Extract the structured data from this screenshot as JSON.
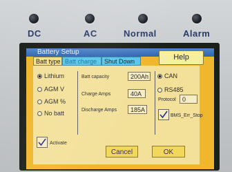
{
  "indicators": [
    {
      "label": "DC"
    },
    {
      "label": "AC"
    },
    {
      "label": "Normal"
    },
    {
      "label": "Alarm"
    }
  ],
  "window": {
    "title": "Battery Setup"
  },
  "help_label": "Help",
  "tabs": [
    {
      "label": "Batt type"
    },
    {
      "label": "Batt charge"
    },
    {
      "label": "Shut Down"
    }
  ],
  "battery_types": [
    {
      "label": "Lithium",
      "selected": true
    },
    {
      "label": "AGM V",
      "selected": false
    },
    {
      "label": "AGM %",
      "selected": false
    },
    {
      "label": "No batt",
      "selected": false
    }
  ],
  "activate": {
    "label": "Activate",
    "checked": true
  },
  "fields": {
    "capacity": {
      "label": "Batt capacity",
      "value": "200Ah"
    },
    "charge_amps": {
      "label": "Charge Amps",
      "value": "40A"
    },
    "discharge_amps": {
      "label": "Discharge Amps",
      "value": "185A"
    }
  },
  "comm": [
    {
      "label": "CAN",
      "selected": true
    },
    {
      "label": "RS485",
      "selected": false
    }
  ],
  "protocol": {
    "label": "Protocol",
    "value": "0"
  },
  "bms_err_stop": {
    "label": "BMS_Err_Stop",
    "checked": true
  },
  "buttons": {
    "cancel": "Cancel",
    "ok": "OK"
  },
  "colors": {
    "screen_bg": "#f0b62c",
    "tab_active": "#58c6ea",
    "titlebar": "#2f64b0"
  }
}
